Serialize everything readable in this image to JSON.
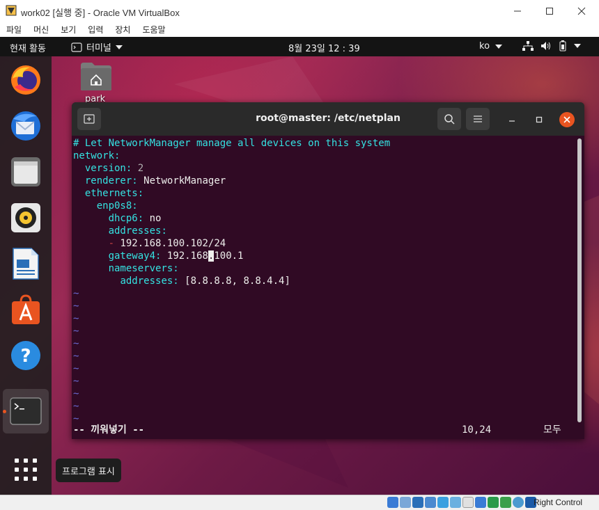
{
  "host": {
    "title": "work02 [실행 중] - Oracle VM VirtualBox",
    "menu": [
      "파일",
      "머신",
      "보기",
      "입력",
      "장치",
      "도움말"
    ],
    "status_text": "Right Control"
  },
  "topbar": {
    "activities": "현재 활동",
    "app_name": "터미널",
    "clock": "8월 23일  12 : 39",
    "lang": "ko"
  },
  "desktop": {
    "home_label": "park"
  },
  "dock": {
    "tooltip": "프로그램 표시"
  },
  "terminal": {
    "title": "root@master: /etc/netplan",
    "lines": {
      "l1": "# Let NetworkManager manage all devices on this system",
      "l2_key": "network",
      "l3_key": "version",
      "l3_val": "2",
      "l4_key": "renderer",
      "l4_val": "NetworkManager",
      "l5_key": "ethernets",
      "l6_key": "enp0s8",
      "l7_key": "dhcp6",
      "l7_val": "no",
      "l8_key": "addresses",
      "l9_dash": "-",
      "l9_val": "192.168.100.102/24",
      "l10_key": "gateway4",
      "l10_val_a": "192.168",
      "l10_cursor": ".",
      "l10_val_b": "100.1",
      "l11_key": "nameservers",
      "l12_key": "addresses",
      "l12_val": "[8.8.8.8, 8.8.4.4]"
    },
    "tilde": "~",
    "status_mode": "-- 끼워넣기 --",
    "status_pos": "10,24",
    "status_all": "모두"
  },
  "colors": {
    "terminal_bg": "#300a24",
    "cyan": "#34e2e2",
    "accent": "#e95420"
  }
}
